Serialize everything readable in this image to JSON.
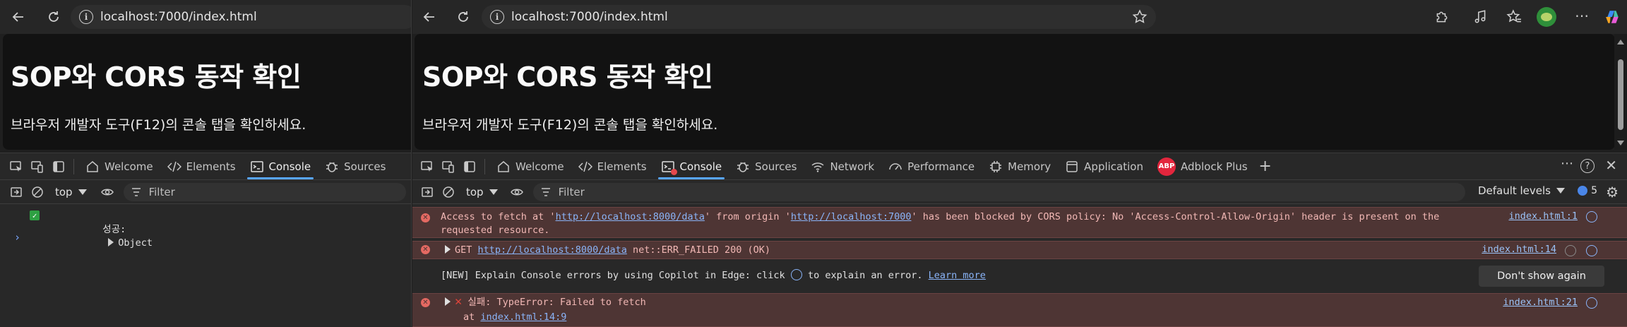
{
  "url": "localhost:7000/index.html",
  "page": {
    "heading": "SOP와 CORS 동작 확인",
    "instruction": "브라우저 개발자 도구(F12)의 콘솔 탭을 확인하세요."
  },
  "devtools": {
    "tabs_left": [
      "Welcome",
      "Elements",
      "Console",
      "Sources"
    ],
    "tabs_right": [
      "Welcome",
      "Elements",
      "Console",
      "Sources",
      "Network",
      "Performance",
      "Memory",
      "Application",
      "Adblock Plus"
    ],
    "abp_badge": "ABP",
    "context": "top",
    "filter_placeholder": "Filter",
    "default_levels": "Default levels",
    "issues_count": "5"
  },
  "console_left": {
    "success_label": "성공:",
    "success_value": "Object"
  },
  "console_right": {
    "cors_error_line1_pre": "Access to fetch at '",
    "cors_error_url1": "http://localhost:8000/data",
    "cors_error_line1_mid": "' from origin '",
    "cors_error_url2": "http://localhost:7000",
    "cors_error_line1_post": "' has been blocked by CORS policy: No 'Access-Control-Allow-Origin' header is present on the",
    "cors_error_line2": "requested resource.",
    "cors_src": "index.html:1",
    "get_method": "GET",
    "get_url": "http://localhost:8000/data",
    "get_status": "net::ERR_FAILED 200 (OK)",
    "get_src": "index.html:14",
    "copilot_pre": "[NEW] Explain Console errors by using Copilot in Edge: click",
    "copilot_post": "to explain an error.",
    "learn_more": "Learn more",
    "dont_show": "Don't show again",
    "fail_label": "실패: TypeError: Failed to fetch",
    "fail_at": "at",
    "fail_at_link": "index.html:14:9",
    "fail_src": "index.html:21"
  }
}
